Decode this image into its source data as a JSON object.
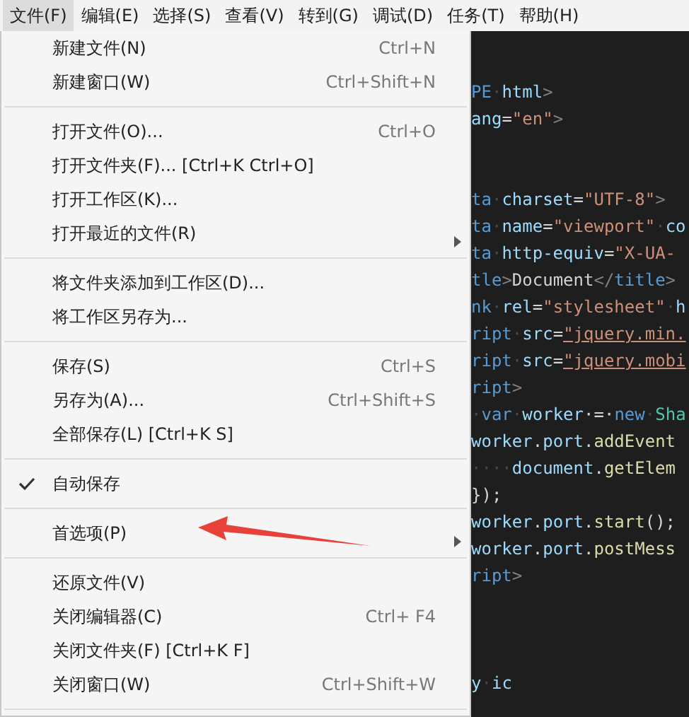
{
  "menu_bar": [
    {
      "label": "文件(F)",
      "selected": true
    },
    {
      "label": "编辑(E)",
      "selected": false
    },
    {
      "label": "选择(S)",
      "selected": false
    },
    {
      "label": "查看(V)",
      "selected": false
    },
    {
      "label": "转到(G)",
      "selected": false
    },
    {
      "label": "调试(D)",
      "selected": false
    },
    {
      "label": "任务(T)",
      "selected": false
    },
    {
      "label": "帮助(H)",
      "selected": false
    }
  ],
  "file_menu": [
    {
      "kind": "item",
      "label": "新建文件(N)",
      "shortcut": "Ctrl+N"
    },
    {
      "kind": "item",
      "label": "新建窗口(W)",
      "shortcut": "Ctrl+Shift+N"
    },
    {
      "kind": "separator"
    },
    {
      "kind": "item",
      "label": "打开文件(O)...",
      "shortcut": "Ctrl+O"
    },
    {
      "kind": "item",
      "label": "打开文件夹(F)... [Ctrl+K Ctrl+O]"
    },
    {
      "kind": "item",
      "label": "打开工作区(K)..."
    },
    {
      "kind": "item",
      "label": "打开最近的文件(R)",
      "submenu": true
    },
    {
      "kind": "separator"
    },
    {
      "kind": "item",
      "label": "将文件夹添加到工作区(D)..."
    },
    {
      "kind": "item",
      "label": "将工作区另存为..."
    },
    {
      "kind": "separator"
    },
    {
      "kind": "item",
      "label": "保存(S)",
      "shortcut": "Ctrl+S"
    },
    {
      "kind": "item",
      "label": "另存为(A)...",
      "shortcut": "Ctrl+Shift+S"
    },
    {
      "kind": "item",
      "label": "全部保存(L) [Ctrl+K S]"
    },
    {
      "kind": "separator"
    },
    {
      "kind": "item",
      "label": "自动保存",
      "checked": true
    },
    {
      "kind": "separator"
    },
    {
      "kind": "item",
      "label": "首选项(P)",
      "submenu": true
    },
    {
      "kind": "separator"
    },
    {
      "kind": "item",
      "label": "还原文件(V)"
    },
    {
      "kind": "item",
      "label": "关闭编辑器(C)",
      "shortcut": "Ctrl+  F4"
    },
    {
      "kind": "item",
      "label": "关闭文件夹(F) [Ctrl+K F]"
    },
    {
      "kind": "item",
      "label": "关闭窗口(W)",
      "shortcut": "Ctrl+Shift+W"
    },
    {
      "kind": "separator"
    }
  ],
  "editor_lines": [
    {
      "kind": "code",
      "segments": [
        {
          "text": "PE",
          "kind": "tag"
        },
        {
          "text": "·",
          "kind": "space"
        },
        {
          "text": "html",
          "kind": "attr"
        },
        {
          "text": ">",
          "kind": "punct"
        }
      ]
    },
    {
      "kind": "code",
      "segments": [
        {
          "text": "ang",
          "kind": "attr"
        },
        {
          "text": "=",
          "kind": "plain"
        },
        {
          "text": "\"en\"",
          "kind": "string"
        },
        {
          "text": ">",
          "kind": "punct"
        }
      ]
    },
    {
      "kind": "blank"
    },
    {
      "kind": "blank"
    },
    {
      "kind": "code",
      "segments": [
        {
          "text": "ta",
          "kind": "tag"
        },
        {
          "text": "·",
          "kind": "space"
        },
        {
          "text": "charset",
          "kind": "attr"
        },
        {
          "text": "=",
          "kind": "plain"
        },
        {
          "text": "\"UTF-8\"",
          "kind": "string"
        },
        {
          "text": ">",
          "kind": "punct"
        }
      ]
    },
    {
      "kind": "code",
      "segments": [
        {
          "text": "ta",
          "kind": "tag"
        },
        {
          "text": "·",
          "kind": "space"
        },
        {
          "text": "name",
          "kind": "attr"
        },
        {
          "text": "=",
          "kind": "plain"
        },
        {
          "text": "\"viewport\"",
          "kind": "string"
        },
        {
          "text": "·",
          "kind": "space"
        },
        {
          "text": "co",
          "kind": "attr"
        }
      ]
    },
    {
      "kind": "code",
      "segments": [
        {
          "text": "ta",
          "kind": "tag"
        },
        {
          "text": "·",
          "kind": "space"
        },
        {
          "text": "http-equiv",
          "kind": "attr"
        },
        {
          "text": "=",
          "kind": "plain"
        },
        {
          "text": "\"X-UA-",
          "kind": "string"
        }
      ]
    },
    {
      "kind": "code",
      "segments": [
        {
          "text": "tle",
          "kind": "tag"
        },
        {
          "text": ">",
          "kind": "punct"
        },
        {
          "text": "Document",
          "kind": "plain"
        },
        {
          "text": "</",
          "kind": "punct"
        },
        {
          "text": "title",
          "kind": "tag"
        },
        {
          "text": ">",
          "kind": "punct"
        }
      ]
    },
    {
      "kind": "code",
      "segments": [
        {
          "text": "nk",
          "kind": "tag"
        },
        {
          "text": "·",
          "kind": "space"
        },
        {
          "text": "rel",
          "kind": "attr"
        },
        {
          "text": "=",
          "kind": "plain"
        },
        {
          "text": "\"stylesheet\"",
          "kind": "string"
        },
        {
          "text": "·",
          "kind": "space"
        },
        {
          "text": "h",
          "kind": "attr"
        }
      ]
    },
    {
      "kind": "code",
      "segments": [
        {
          "text": "ript",
          "kind": "tag"
        },
        {
          "text": "·",
          "kind": "space"
        },
        {
          "text": "src",
          "kind": "attr"
        },
        {
          "text": "=",
          "kind": "plain"
        },
        {
          "text": "\"jquery.min.",
          "kind": "link"
        }
      ]
    },
    {
      "kind": "code",
      "segments": [
        {
          "text": "ript",
          "kind": "tag"
        },
        {
          "text": "·",
          "kind": "space"
        },
        {
          "text": "src",
          "kind": "attr"
        },
        {
          "text": "=",
          "kind": "plain"
        },
        {
          "text": "\"jquery.mobi",
          "kind": "link"
        }
      ]
    },
    {
      "kind": "code",
      "segments": [
        {
          "text": "ript",
          "kind": "tag"
        },
        {
          "text": ">",
          "kind": "punct"
        }
      ]
    },
    {
      "kind": "code",
      "segments": [
        {
          "text": "·",
          "kind": "space"
        },
        {
          "text": "var",
          "kind": "tag"
        },
        {
          "text": "·",
          "kind": "space"
        },
        {
          "text": "worker",
          "kind": "attr"
        },
        {
          "text": "·=·",
          "kind": "plain"
        },
        {
          "text": "new",
          "kind": "tag"
        },
        {
          "text": "·",
          "kind": "space"
        },
        {
          "text": "Sha",
          "kind": "class"
        }
      ]
    },
    {
      "kind": "code",
      "segments": [
        {
          "text": "worker",
          "kind": "attr"
        },
        {
          "text": ".",
          "kind": "plain"
        },
        {
          "text": "port",
          "kind": "attr"
        },
        {
          "text": ".",
          "kind": "plain"
        },
        {
          "text": "addEvent",
          "kind": "func"
        }
      ]
    },
    {
      "kind": "code",
      "segments": [
        {
          "text": "····",
          "kind": "space"
        },
        {
          "text": "document",
          "kind": "attr"
        },
        {
          "text": ".",
          "kind": "plain"
        },
        {
          "text": "getElem",
          "kind": "func"
        }
      ]
    },
    {
      "kind": "code",
      "segments": [
        {
          "text": "});",
          "kind": "plain"
        }
      ]
    },
    {
      "kind": "code",
      "segments": [
        {
          "text": "worker",
          "kind": "attr"
        },
        {
          "text": ".",
          "kind": "plain"
        },
        {
          "text": "port",
          "kind": "attr"
        },
        {
          "text": ".",
          "kind": "plain"
        },
        {
          "text": "start",
          "kind": "func"
        },
        {
          "text": "();",
          "kind": "plain"
        }
      ]
    },
    {
      "kind": "code",
      "segments": [
        {
          "text": "worker",
          "kind": "attr"
        },
        {
          "text": ".",
          "kind": "plain"
        },
        {
          "text": "port",
          "kind": "attr"
        },
        {
          "text": ".",
          "kind": "plain"
        },
        {
          "text": "postMess",
          "kind": "func"
        }
      ]
    },
    {
      "kind": "code",
      "segments": [
        {
          "text": "ript",
          "kind": "tag"
        },
        {
          "text": ">",
          "kind": "punct"
        }
      ]
    },
    {
      "kind": "blank"
    },
    {
      "kind": "blank"
    },
    {
      "kind": "blank"
    },
    {
      "kind": "code",
      "segments": [
        {
          "text": "y",
          "kind": "attr"
        },
        {
          "text": "·",
          "kind": "space"
        },
        {
          "text": "ic",
          "kind": "attr"
        }
      ]
    }
  ],
  "annotation": {
    "kind": "arrow"
  }
}
